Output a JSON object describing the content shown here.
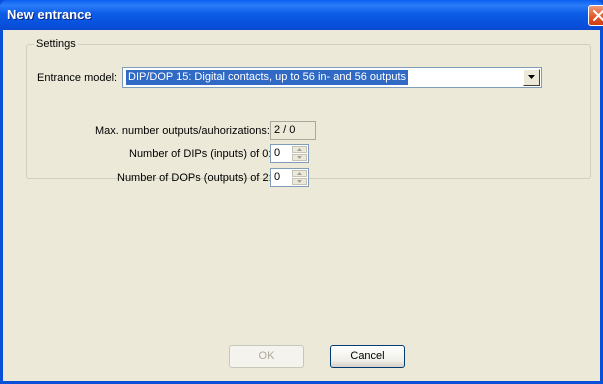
{
  "window": {
    "title": "New entrance",
    "close_icon": "close-icon",
    "accent": "#0a4fd8"
  },
  "settings": {
    "legend": "Settings",
    "entrance_model_label": "Entrance model:",
    "entrance_model_value": "DIP/DOP 15: Digital contacts, up to 56 in- and 56 outputs",
    "max_outputs_label": "Max. number outputs/auhorizations:",
    "max_outputs_value": "2 / 0",
    "dips_label": "Number of DIPs (inputs) of 0:",
    "dips_value": "0",
    "dops_label": "Number of DOPs (outputs) of 2:",
    "dops_value": "0"
  },
  "buttons": {
    "ok_label": "OK",
    "cancel_label": "Cancel"
  }
}
